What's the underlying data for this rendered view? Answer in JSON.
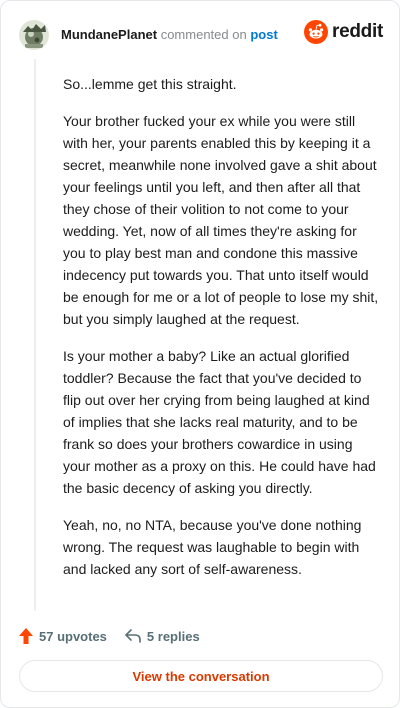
{
  "header": {
    "username": "MundanePlanet",
    "commented_text": "commented on",
    "post_link": "post",
    "brand": "reddit",
    "brand_color": "#ff4500",
    "avatar_icon": "avatar-planet-icon"
  },
  "comment": {
    "paragraphs": [
      "So...lemme get this straight.",
      "Your brother fucked your ex while you were still with her, your parents enabled this by keeping it a secret, meanwhile none involved gave a shit about your feelings until you left, and then after all that they chose of their volition to not come to your wedding. Yet, now of all times they're asking for you to play best man and condone this massive indecency put towards you. That unto itself would be enough for me or a lot of people to lose my shit, but you simply laughed at the request.",
      "Is your mother a baby? Like an actual glorified toddler? Because the fact that you've decided to flip out over her crying from being laughed at kind of implies that she lacks real maturity, and to be frank so does your brothers cowardice in using your mother as a proxy on this. He could have had the basic decency of asking you directly.",
      "Yeah, no, no NTA, because you've done nothing wrong. The request was laughable to begin with and lacked any sort of self-awareness."
    ]
  },
  "actions": {
    "upvotes": "57 upvotes",
    "replies": "5 replies",
    "upvote_icon": "upvote-arrow-icon",
    "reply_icon": "reply-arrow-icon",
    "upvote_color": "#ff4500"
  },
  "cta": {
    "label": "View the conversation",
    "color": "#d93a00"
  }
}
